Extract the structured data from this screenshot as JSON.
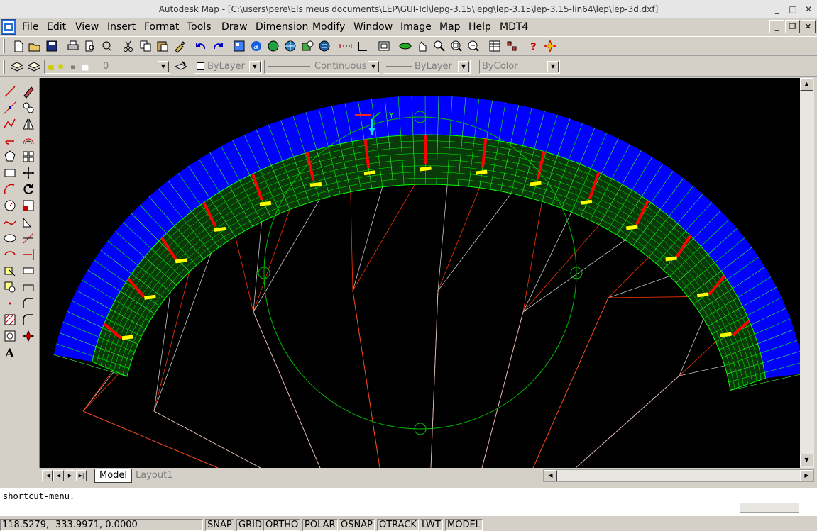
{
  "window": {
    "title": "Autodesk Map - [C:\\users\\pere\\Els meus documents\\LEP\\GUI-Tcl\\lepg-3.15\\lepg\\lep-3.15\\lep-3.15-lin64\\lep\\lep-3d.dxf]",
    "controls": [
      "_",
      "□",
      "✕"
    ]
  },
  "menu": {
    "items": [
      "File",
      "Edit",
      "View",
      "Insert",
      "Format",
      "Tools",
      "Draw",
      "Dimension",
      "Modify",
      "Window",
      "Image",
      "Map",
      "Help",
      "MDT4"
    ],
    "mdi_controls": [
      "_",
      "❐",
      "✕"
    ]
  },
  "layers_toolbar": {
    "layer_value": "0",
    "color_value": "ByLayer",
    "linetype_value": "Continuous",
    "lineweight_value": "ByLayer",
    "plotstyle_value": "ByColor"
  },
  "tabs": {
    "model": "Model",
    "layout": "Layout1"
  },
  "command": {
    "line": "shortcut-menu."
  },
  "status": {
    "coords": "118.5279, -333.9971, 0.0000",
    "buttons": [
      "SNAP",
      "GRID",
      "ORTHO",
      "POLAR",
      "OSNAP",
      "OTRACK",
      "LWT",
      "MODEL"
    ]
  },
  "viewport": {
    "ucs_y_label": "Y",
    "colors": {
      "background": "#000000",
      "canopy_top": "#0000ff",
      "canopy_ribs": "#00ff00",
      "highlight": "#ffff00",
      "accent": "#ff0000"
    }
  }
}
